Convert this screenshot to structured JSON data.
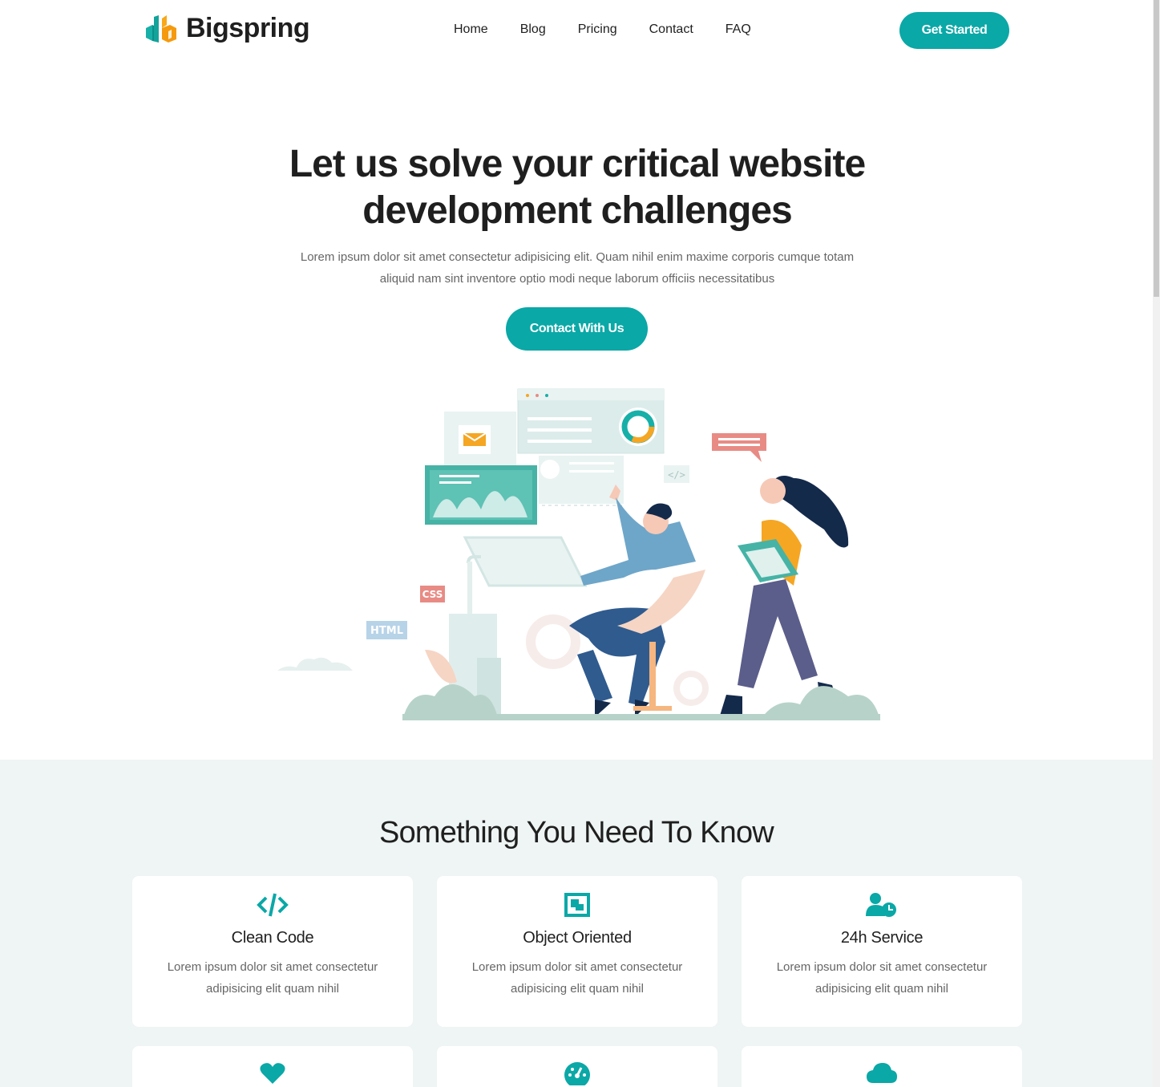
{
  "brand": {
    "name": "Bigspring"
  },
  "nav": {
    "items": [
      "Home",
      "Blog",
      "Pricing",
      "Contact",
      "FAQ"
    ]
  },
  "header": {
    "cta_label": "Get Started"
  },
  "hero": {
    "title": "Let us solve your critical website development challenges",
    "description": "Lorem ipsum dolor sit amet consectetur adipisicing elit. Quam nihil enim maxime corporis cumque totam aliquid nam sint inventore optio modi neque laborum officiis necessitatibus",
    "cta_label": "Contact With Us",
    "illustration_tags": [
      "CSS",
      "HTML",
      "</>"
    ]
  },
  "features": {
    "title": "Something You Need To Know",
    "cards": [
      {
        "icon": "code-icon",
        "title": "Clean Code",
        "text": "Lorem ipsum dolor sit amet consectetur adipisicing elit quam nihil"
      },
      {
        "icon": "object-icon",
        "title": "Object Oriented",
        "text": "Lorem ipsum dolor sit amet consectetur adipisicing elit quam nihil"
      },
      {
        "icon": "user-clock-icon",
        "title": "24h Service",
        "text": "Lorem ipsum dolor sit amet consectetur adipisicing elit quam nihil"
      },
      {
        "icon": "heart-icon",
        "title": "",
        "text": ""
      },
      {
        "icon": "speedometer-icon",
        "title": "",
        "text": ""
      },
      {
        "icon": "cloud-icon",
        "title": "",
        "text": ""
      }
    ]
  },
  "colors": {
    "accent": "#0aa8a7",
    "section_bg": "#eef5f4",
    "heading": "#1f1f1f",
    "body_text": "#666666"
  }
}
